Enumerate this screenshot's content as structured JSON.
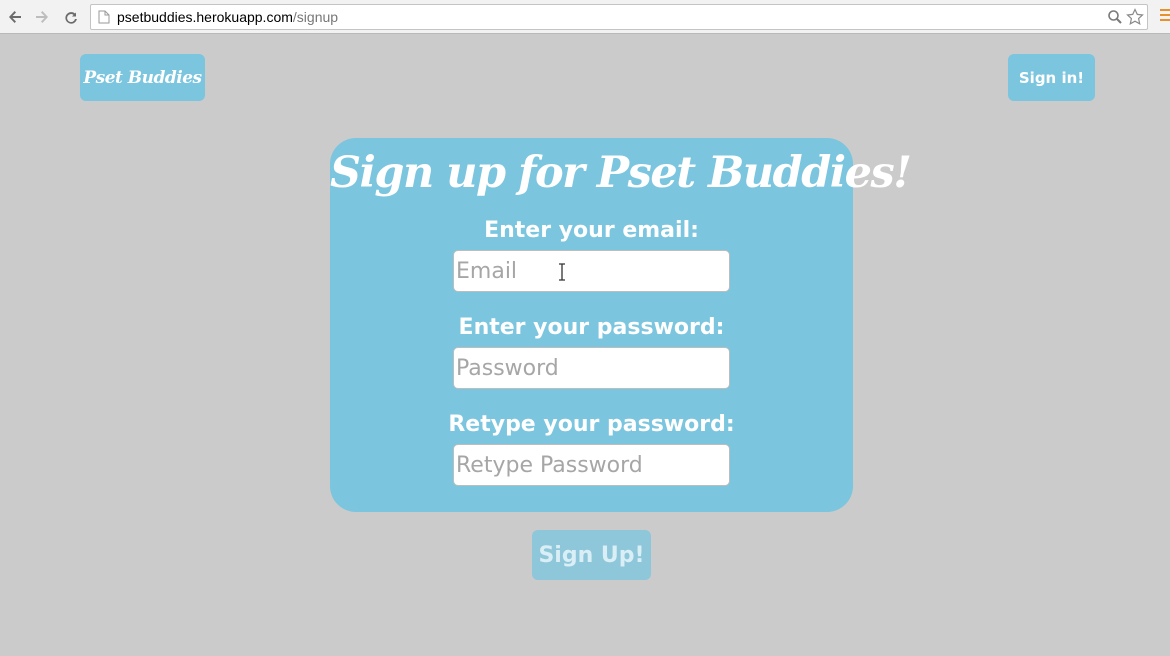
{
  "browser": {
    "url_host": "psetbuddies.herokuapp.com",
    "url_path": "/signup"
  },
  "header": {
    "logo_label": "Pset Buddies",
    "signin_label": "Sign in!"
  },
  "form": {
    "title": "Sign up for Pset Buddies!",
    "email": {
      "label": "Enter your email:",
      "placeholder": "Email",
      "value": ""
    },
    "password": {
      "label": "Enter your password:",
      "placeholder": "Password",
      "value": ""
    },
    "retype_password": {
      "label": "Retype your password:",
      "placeholder": "Retype Password",
      "value": ""
    },
    "submit_label": "Sign Up!"
  },
  "colors": {
    "page_background": "#cbcbcb",
    "accent": "#7bc5df",
    "submit_disabled": "#8ec6da"
  },
  "icons": [
    "back-icon",
    "forward-icon",
    "reload-icon",
    "page-icon",
    "zoom-icon",
    "star-icon",
    "menu-icon",
    "text-cursor-icon"
  ]
}
